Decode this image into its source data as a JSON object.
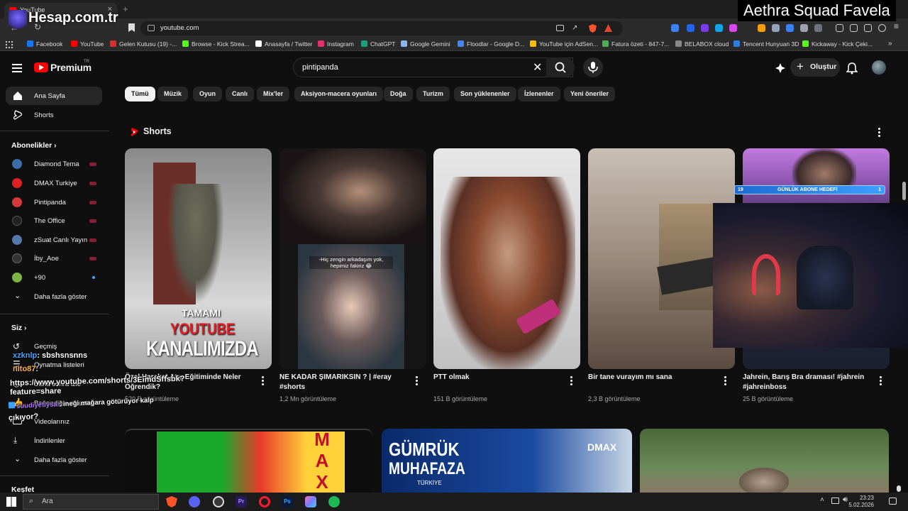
{
  "overlay": {
    "channel_title": "Aethra Squad Favela",
    "site_brand": "Hesap.com.tr"
  },
  "browser": {
    "tab_title": "YouTube",
    "url": "youtube.com",
    "bookmarks": [
      "Facebook",
      "YouTube",
      "Gelen Kutusu (19) -...",
      "Browse - Kick Strea...",
      "Anasayfa / Twitter",
      "Instagram",
      "ChatGPT",
      "Google Gemini",
      "Floodlar - Google D...",
      "YouTube için AdSen...",
      "Fatura özeti - 847-7...",
      "BELABOX cloud",
      "Tencent Hunyuan 3D",
      "Kickaway - Kick Çeki..."
    ],
    "bookmark_colors": [
      "#1877f2",
      "#ff0000",
      "#d93025",
      "#53fc18",
      "#ffffff",
      "#e1306c",
      "#10a37f",
      "#8ab4f8",
      "#4285f4",
      "#fbbc04",
      "#4caf50",
      "#888888",
      "#2a7de1",
      "#53fc18"
    ]
  },
  "header": {
    "logo_text": "Premium",
    "logo_sup": "TR",
    "search_query": "pintipanda",
    "create_label": "Oluştur"
  },
  "sidebar": {
    "home": "Ana Sayfa",
    "shorts": "Shorts",
    "subs_header": "Abonelikler",
    "subscriptions": [
      {
        "name": "Diamond Tema",
        "color": "#3b6ea8"
      },
      {
        "name": "DMAX Turkiye",
        "color": "#e02020"
      },
      {
        "name": "Pintipanda",
        "color": "#d23a3a"
      },
      {
        "name": "The Office",
        "color": "#222222"
      },
      {
        "name": "zSuat Canlı Yayın",
        "color": "#5577aa"
      },
      {
        "name": "İby_Aoe",
        "color": "#333333"
      },
      {
        "name": "+90",
        "color": "#7cb342"
      }
    ],
    "show_more": "Daha fazla göster",
    "you_header": "Siz",
    "you_items": [
      "Geçmiş",
      "Oynatma listeleri",
      "Daha sonra izle",
      "Beğendiğin videolar",
      "Videolarınız",
      "İndirilenler"
    ],
    "show_more_2": "Daha fazla göster",
    "explore": "Keşfet"
  },
  "chips": [
    "Tümü",
    "Müzik",
    "Oyun",
    "Canlı",
    "Mix'ler",
    "Aksiyon-macera oyunları",
    "Doğa",
    "Turizm",
    "Son yüklenenler",
    "İzlenenler",
    "Yeni öneriler"
  ],
  "shorts_section": {
    "title": "Shorts",
    "items": [
      {
        "title": "Özel Harekat Atış Eğitiminde Neler Öğrendik?",
        "views": "520 B görüntüleme",
        "thumb_text_1": "TAMAMI",
        "thumb_text_2": "YOUTUBE",
        "thumb_text_3": "KANALIMIZDA"
      },
      {
        "title": "NE KADAR ŞIMARIKSIN ? | #eray #shorts",
        "views": "1,2 Mn görüntüleme",
        "thumb_text_1": "-Hiç zengin arkadaşım yok, hepimiz fakiriz 😂"
      },
      {
        "title": "PTT olmak",
        "views": "151 B görüntüleme"
      },
      {
        "title": "Bir tane vurayım mı sana",
        "views": "2,3 B görüntüleme"
      },
      {
        "title": "Jahrein, Barış Bra draması! #jahrein #jahreinboss",
        "views": "25 B görüntüleme",
        "thumb_text_1": "GÜNLÜK ABONE HEDEFİ",
        "thumb_num_left": "19",
        "thumb_num_right": "1"
      }
    ]
  },
  "videos_row": {
    "thumb_1_text": "MAX",
    "thumb_2_text_1": "GÜMRÜK",
    "thumb_2_text_2": "MUHAFAZA",
    "thumb_2_text_3": "TÜRKİYE",
    "thumb_2_brand": "DMAX"
  },
  "chat_overlay": [
    {
      "user": "xzknlp",
      "msg": ": sbshsnsnns",
      "color": "#4aa3ff"
    },
    {
      "user": "nito87",
      "msg": ":",
      "color": "#ffb347"
    },
    {
      "user": "",
      "msg": "https://www.youtube.com/shorts/3EimdSffsbk?",
      "color": "#ffffff"
    },
    {
      "user": "",
      "msg": "feature=share",
      "color": "#ffffff"
    },
    {
      "user": "suudiyefiysal",
      "msg": ": ineği mağara götürüyor kalp",
      "color": "#b57cff"
    },
    {
      "user": "",
      "msg": "çıkıyor?",
      "color": "#ffffff"
    }
  ],
  "taskbar": {
    "search_placeholder": "Ara",
    "time": "23:23",
    "date": "5.02.2026"
  }
}
